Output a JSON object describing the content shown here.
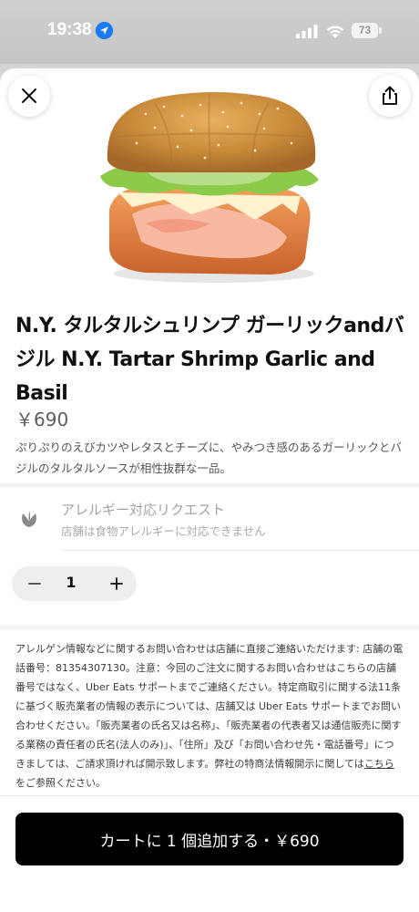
{
  "status_bar": {
    "time": "19:38",
    "battery": "73",
    "icons": [
      "location-arrow-icon",
      "cellular-signal-icon",
      "wifi-icon",
      "battery-icon"
    ]
  },
  "header": {
    "icons": [
      "close-icon",
      "share-icon"
    ]
  },
  "item": {
    "title": "N.Y. タルタルシュリンプ ガーリックandバジル N.Y. Tartar Shrimp Garlic and Basil",
    "price": "￥690",
    "description": "ぷりぷりのえびカツやレタスとチーズに、やみつき感のあるガーリックとバジルのタルタルソースが相性抜群な一品。"
  },
  "allergy": {
    "title": "アレルギー対応リクエスト",
    "subtitle": "店舗は食物アレルギーに対応できません",
    "icon": "allergy-leaf-icon"
  },
  "stepper": {
    "quantity": "1",
    "icons": [
      "minus-icon",
      "plus-icon"
    ]
  },
  "legal": {
    "text_before_link": "アレルゲン情報などに関するお問い合わせは店舗に直接ご連絡いただけます: 店舗の電話番号：81354307130。注意：今回のご注文に関するお問い合わせはこちらの店舗番号ではなく、Uber Eats サポートまでご連絡ください。特定商取引に関する法11条に基づく販売業者の情報の表示については、店舗又は Uber Eats サポートまでお問い合わせください。「販売業者の氏名又は名称」、「販売業者の代表者又は通信販売に関する業務の責任者の氏名(法人のみ)」、「住所」及び「お問い合わせ先・電話番号」につきましては、ご請求頂ければ開示致します。弊社の特商法情報開示に関しては",
    "link": "こちら",
    "text_after_link": "をご参照ください。"
  },
  "cart_button": {
    "label": "カートに 1 個追加する・￥690"
  }
}
